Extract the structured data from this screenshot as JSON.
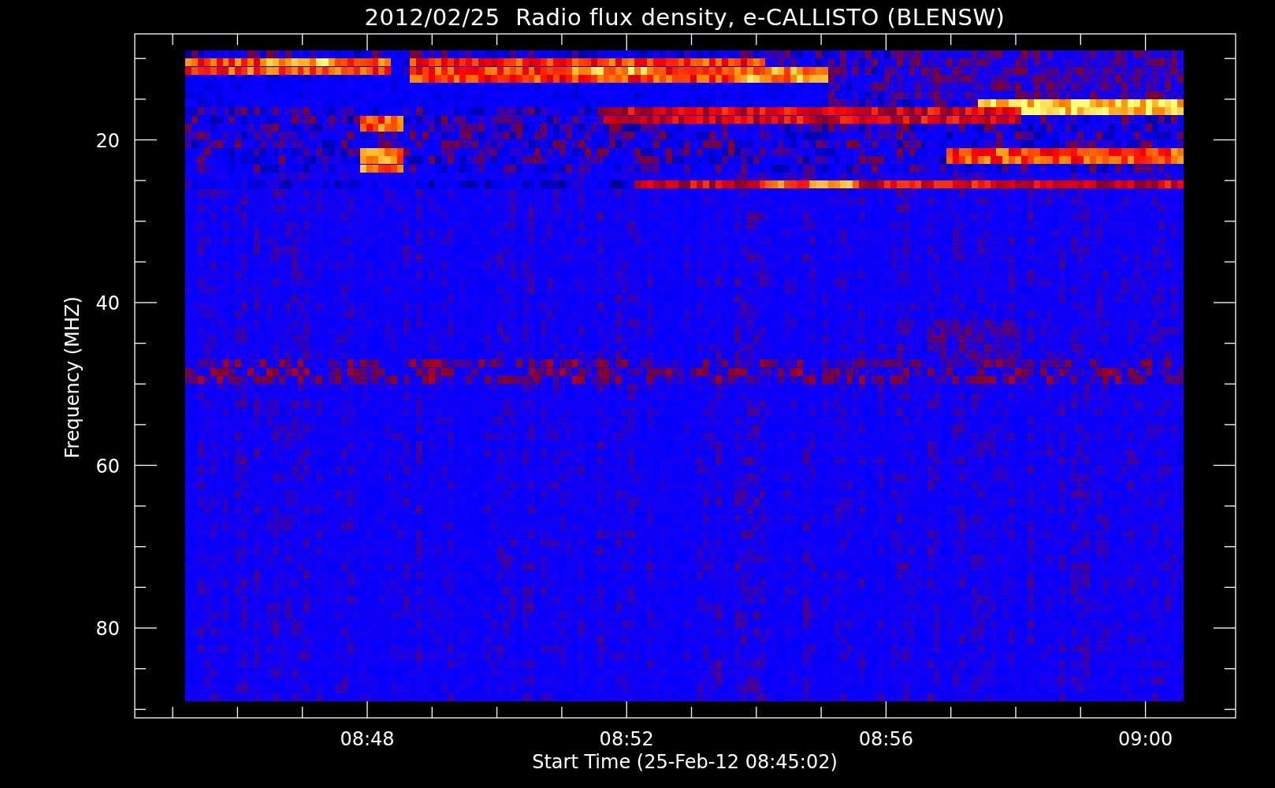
{
  "title": "2012/02/25  Radio flux density, e-CALLISTO (BLENSW)",
  "y_axis": {
    "label": "Frequency (MHZ)",
    "ticks": [
      "20",
      "40",
      "60",
      "80"
    ]
  },
  "x_axis": {
    "label": "Start Time (25-Feb-12 08:45:02)",
    "ticks": [
      "08:48",
      "08:52",
      "08:56",
      "09:00"
    ]
  }
}
